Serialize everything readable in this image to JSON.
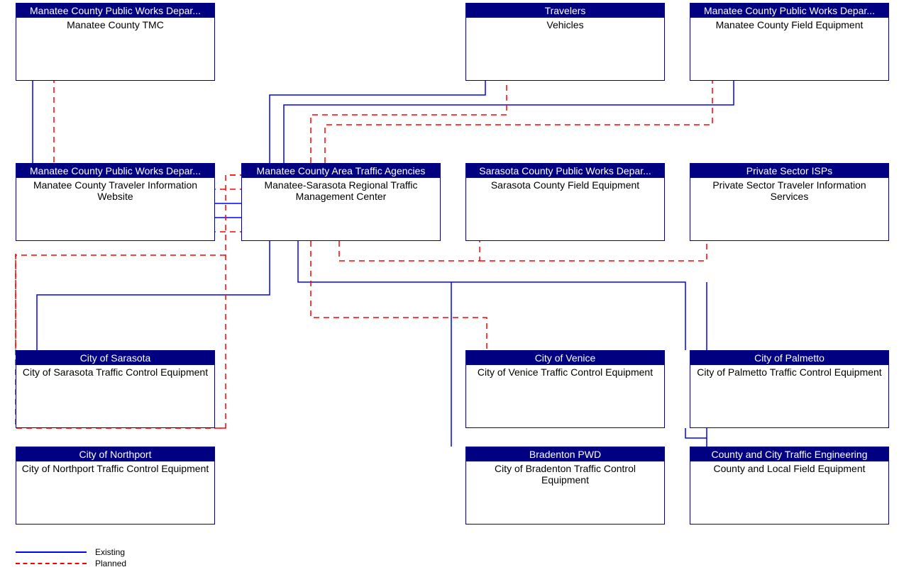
{
  "legend": {
    "existing_label": "Existing",
    "planned_label": "Planned",
    "existing_color": "#0000ff",
    "planned_color": "#ff0000"
  },
  "nodes": {
    "manatee_tmc": {
      "title": "Manatee County Public Works Depar...",
      "subtitle": "Manatee County TMC"
    },
    "vehicles": {
      "title": "Travelers",
      "subtitle": "Vehicles"
    },
    "manatee_field_equipment": {
      "title": "Manatee County Public Works Depar...",
      "subtitle": "Manatee County Field Equipment"
    },
    "manatee_traveler_info": {
      "title": "Manatee County Public Works Depar...",
      "subtitle": "Manatee County Traveler Information Website"
    },
    "manatee_sarasota_center": {
      "title": "Manatee County Area Traffic Agencies",
      "subtitle": "Manatee-Sarasota Regional Traffic Management Center"
    },
    "sarasota_field_equipment": {
      "title": "Sarasota County Public Works Depar...",
      "subtitle": "Sarasota County Field Equipment"
    },
    "private_isps": {
      "title": "Private Sector ISPs",
      "subtitle": "Private Sector Traveler Information Services"
    },
    "sarasota_traffic_control": {
      "title": "City of Sarasota",
      "subtitle": "City of Sarasota Traffic Control Equipment"
    },
    "venice_traffic_control": {
      "title": "City of Venice",
      "subtitle": "City of Venice Traffic Control Equipment"
    },
    "palmetto_traffic_control": {
      "title": "City of Palmetto",
      "subtitle": "City of Palmetto Traffic Control Equipment"
    },
    "northport_traffic_control": {
      "title": "City of Northport",
      "subtitle": "City of Northport Traffic Control Equipment"
    },
    "bradenton_traffic_control": {
      "title": "Bradenton PWD",
      "subtitle": "City of Bradenton Traffic Control Equipment"
    },
    "county_local_field": {
      "title": "County and City Traffic Engineering",
      "subtitle": "County and Local Field Equipment"
    }
  },
  "connections": [
    {
      "from": "manatee_sarasota_center",
      "to": "manatee_tmc",
      "type": "existing"
    },
    {
      "from": "manatee_sarasota_center",
      "to": "vehicles",
      "type": "existing"
    },
    {
      "from": "manatee_sarasota_center",
      "to": "manatee_field_equipment",
      "type": "existing"
    },
    {
      "from": "manatee_sarasota_center",
      "to": "manatee_traveler_info",
      "type": "existing"
    },
    {
      "from": "manatee_sarasota_center",
      "to": "sarasota_traffic_control",
      "type": "existing"
    },
    {
      "from": "manatee_sarasota_center",
      "to": "palmetto_traffic_control",
      "type": "existing"
    },
    {
      "from": "manatee_sarasota_center",
      "to": "bradenton_traffic_control",
      "type": "existing"
    },
    {
      "from": "manatee_sarasota_center",
      "to": "county_local_field",
      "type": "existing"
    },
    {
      "from": "manatee_sarasota_center",
      "to": "manatee_tmc",
      "type": "planned"
    },
    {
      "from": "manatee_sarasota_center",
      "to": "vehicles",
      "type": "planned"
    },
    {
      "from": "manatee_sarasota_center",
      "to": "manatee_field_equipment",
      "type": "planned"
    },
    {
      "from": "manatee_sarasota_center",
      "to": "manatee_traveler_info",
      "type": "planned"
    },
    {
      "from": "manatee_sarasota_center",
      "to": "sarasota_field_equipment",
      "type": "planned"
    },
    {
      "from": "manatee_sarasota_center",
      "to": "private_isps",
      "type": "planned"
    },
    {
      "from": "manatee_sarasota_center",
      "to": "sarasota_traffic_control",
      "type": "planned"
    },
    {
      "from": "manatee_sarasota_center",
      "to": "venice_traffic_control",
      "type": "planned"
    },
    {
      "from": "manatee_sarasota_center",
      "to": "northport_traffic_control",
      "type": "planned"
    }
  ]
}
